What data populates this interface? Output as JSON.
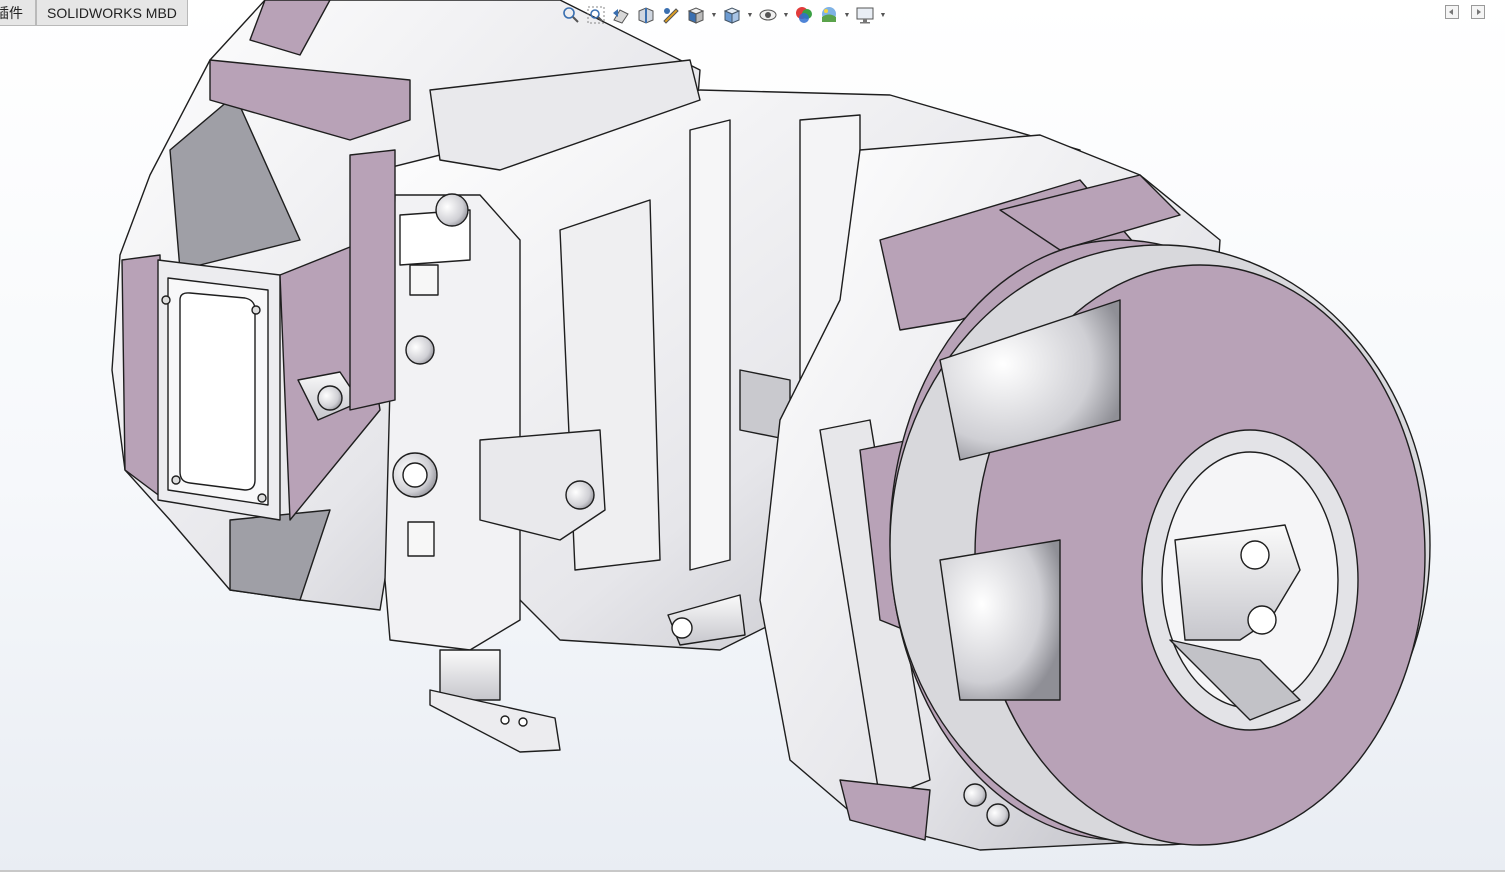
{
  "tabs": [
    {
      "label": "插件"
    },
    {
      "label": "SOLIDWORKS MBD"
    }
  ],
  "heads_up_toolbar": [
    {
      "name": "zoom-to-fit-icon"
    },
    {
      "name": "zoom-to-area-icon"
    },
    {
      "name": "previous-view-icon"
    },
    {
      "name": "section-view-icon"
    },
    {
      "name": "dynamic-annotation-icon"
    },
    {
      "name": "view-orientation-icon"
    },
    {
      "name": "display-style-icon"
    },
    {
      "name": "hide-show-items-icon"
    },
    {
      "name": "edit-appearance-icon"
    },
    {
      "name": "apply-scene-icon"
    },
    {
      "name": "view-settings-icon"
    }
  ],
  "colors": {
    "part_face": "#f1f1f3",
    "part_shade": "#d4d4d8",
    "cut_face": "#b8a2b7",
    "edge": "#1e1e1e",
    "background_top": "#ffffff",
    "background_bottom": "#e9edf3"
  }
}
